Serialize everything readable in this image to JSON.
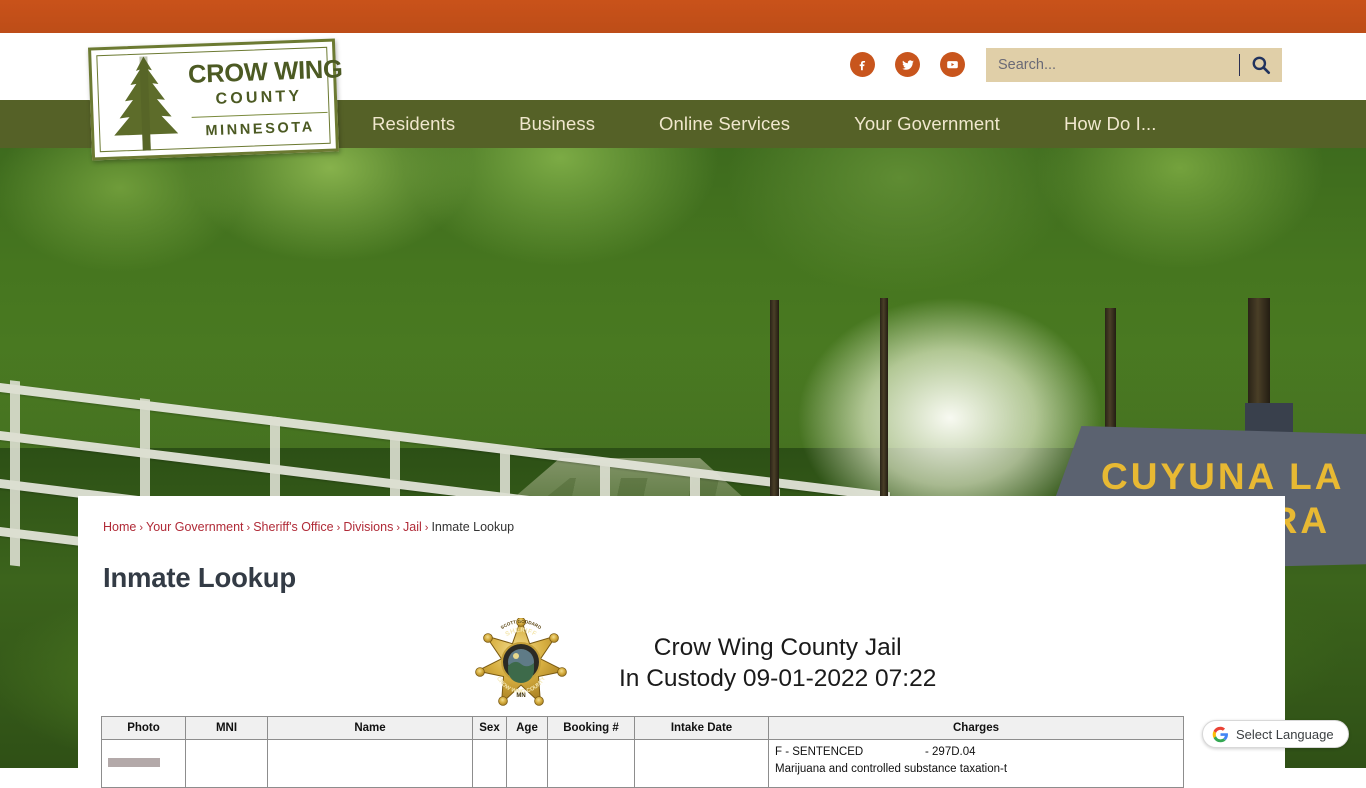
{
  "topbar": {
    "color": "#c4511b"
  },
  "logo": {
    "line1": "CROW WING",
    "line2": "COUNTY",
    "line3": "MINNESOTA",
    "tree_icon": "pine-tree-icon",
    "color": "#4c5a23"
  },
  "social": [
    {
      "name": "facebook-icon",
      "label": "Facebook"
    },
    {
      "name": "twitter-icon",
      "label": "Twitter"
    },
    {
      "name": "youtube-icon",
      "label": "YouTube"
    }
  ],
  "search": {
    "placeholder": "Search...",
    "value": "",
    "icon": "search-icon",
    "background": "#e0cfa8"
  },
  "nav": {
    "background": "#556127",
    "text_color": "#f0e7cd",
    "items": [
      {
        "label": "Residents"
      },
      {
        "label": "Business"
      },
      {
        "label": "Online Services"
      },
      {
        "label": "Your Government"
      },
      {
        "label": "How Do I..."
      }
    ]
  },
  "hero": {
    "alt": "Paved forest trail with white rail fence",
    "sign_line1": "CUYUNA LA",
    "sign_line2": "STATE TRA"
  },
  "breadcrumb": {
    "items": [
      {
        "label": "Home",
        "link": true
      },
      {
        "label": "Your Government",
        "link": true
      },
      {
        "label": "Sheriff's Office",
        "link": true
      },
      {
        "label": "Divisions",
        "link": true
      },
      {
        "label": "Jail",
        "link": true
      },
      {
        "label": "Inmate Lookup",
        "link": false
      }
    ],
    "separator": "›"
  },
  "page": {
    "title": "Inmate Lookup"
  },
  "jail": {
    "badge_icon": "sheriff-star-badge-icon",
    "badge_text": {
      "sheriff": "SHERIFF",
      "name": "SCOTT GODDARD",
      "county": "CROW WING COUNTY",
      "state": "MN"
    },
    "title_line1": "Crow Wing County Jail",
    "title_line2": "In Custody 09-01-2022 07:22"
  },
  "table": {
    "columns": [
      {
        "label": "Photo"
      },
      {
        "label": "MNI"
      },
      {
        "label": "Name"
      },
      {
        "label": "Sex"
      },
      {
        "label": "Age"
      },
      {
        "label": "Booking #"
      },
      {
        "label": "Intake Date"
      },
      {
        "label": "Charges"
      }
    ],
    "rows": [
      {
        "photo": "broken-image-placeholder",
        "mni": "",
        "name": "",
        "sex": "",
        "age": "",
        "booking": "",
        "intake": "",
        "charges": [
          {
            "status": "F  -  SENTENCED",
            "statute": "-  297D.04"
          },
          {
            "status": "Marijuana and controlled substance taxation-t",
            "statute": ""
          }
        ]
      }
    ]
  },
  "translate": {
    "label": "Select Language",
    "icon": "google-g-icon"
  }
}
